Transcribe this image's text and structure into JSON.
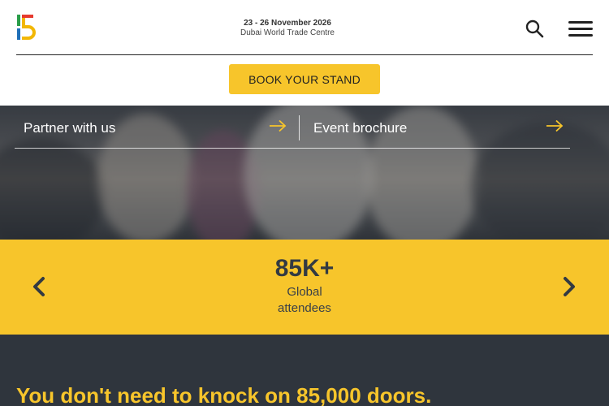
{
  "header": {
    "event_date": "23 - 26 November 2026",
    "event_venue": "Dubai World Trade Centre",
    "book_button": "BOOK YOUR STAND",
    "logo_colors": [
      "#2a9d4a",
      "#e63a2e",
      "#f2b705",
      "#1f6fb8"
    ]
  },
  "hero": {
    "links": [
      {
        "label": "Partner with us",
        "icon": "arrow-right-icon"
      },
      {
        "label": "Event brochure",
        "icon": "arrow-right-icon"
      }
    ]
  },
  "stats": {
    "value": "85K+",
    "label": "Global attendees"
  },
  "headline": "You don't need to knock on 85,000 doors.",
  "colors": {
    "accent": "#f7c52b",
    "dark": "#2f353d"
  }
}
